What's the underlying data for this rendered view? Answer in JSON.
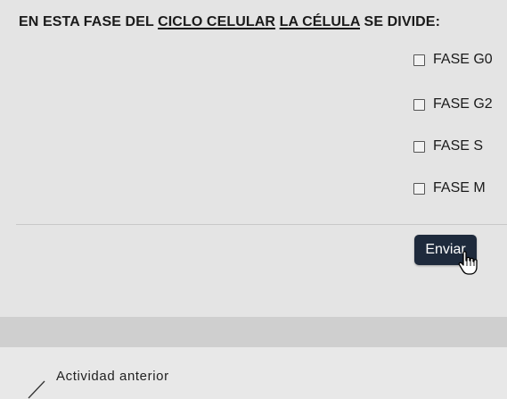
{
  "question": {
    "part1": "EN ESTA FASE DEL ",
    "part2": "CICLO CELULAR",
    "part3": " ",
    "part4": "LA CÉLULA",
    "part5": " SE DIVIDE:"
  },
  "options": [
    {
      "label": "FASE G0",
      "checked": false
    },
    {
      "label": "FASE G2",
      "checked": false
    },
    {
      "label": "FASE S",
      "checked": false
    },
    {
      "label": "FASE M",
      "checked": false
    }
  ],
  "submit_label": "Enviar",
  "previous_activity": "Actividad anterior",
  "colors": {
    "button_bg": "#1e2a3c",
    "page_bg": "#e4e4e4"
  }
}
